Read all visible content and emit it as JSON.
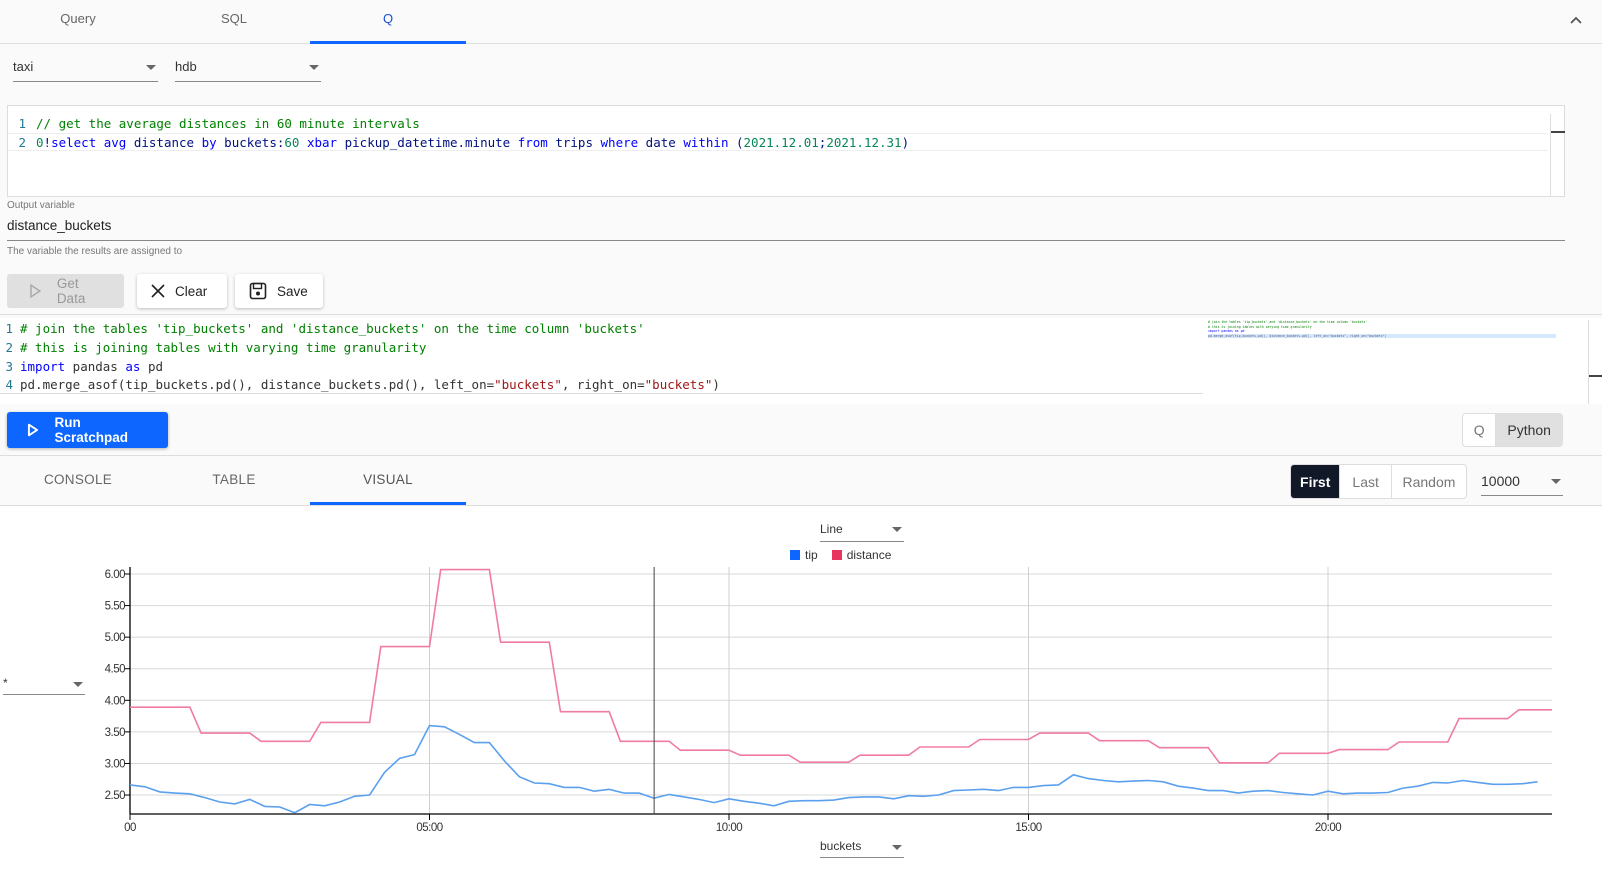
{
  "top_tabs": [
    {
      "label": "Query",
      "active": false
    },
    {
      "label": "SQL",
      "active": false
    },
    {
      "label": "Q",
      "active": true
    }
  ],
  "collapse_icon": "chevron-up-icon",
  "database_select": {
    "value": "taxi"
  },
  "source_select": {
    "value": "hdb"
  },
  "query_editor": {
    "lines": [
      "// get the average distances in 60 minute intervals",
      "0!select avg distance by buckets:60 xbar pickup_datetime.minute from trips where date within (2021.12.01;2021.12.31)"
    ]
  },
  "output_variable": {
    "label": "Output variable",
    "value": "distance_buckets",
    "hint": "The variable the results are assigned to"
  },
  "actions": {
    "get_data": "Get Data",
    "clear": "Clear",
    "save": "Save"
  },
  "scratchpad_editor": {
    "lines": [
      "# join the tables 'tip_buckets' and 'distance_buckets' on the time column 'buckets'",
      "# this is joining tables with varying time granularity",
      "import pandas as pd",
      "pd.merge_asof(tip_buckets.pd(), distance_buckets.pd(), left_on=\"buckets\", right_on=\"buckets\")"
    ]
  },
  "run_scratchpad": "Run Scratchpad",
  "language_toggle": [
    {
      "label": "Q",
      "active": false
    },
    {
      "label": "Python",
      "active": true
    }
  ],
  "result_tabs": [
    {
      "label": "CONSOLE",
      "active": false
    },
    {
      "label": "TABLE",
      "active": false
    },
    {
      "label": "VISUAL",
      "active": true
    }
  ],
  "sample_mode": [
    {
      "label": "First",
      "active": true
    },
    {
      "label": "Last",
      "active": false
    },
    {
      "label": "Random",
      "active": false
    }
  ],
  "row_limit": {
    "value": "10000"
  },
  "chart_type_select": {
    "value": "Line"
  },
  "y_select": {
    "value": "*"
  },
  "x_select": {
    "value": "buckets"
  },
  "colors": {
    "tip": "#5aa0ee",
    "distance": "#f07ca0",
    "accent": "#0d66ff",
    "legend_tip": "#0d66ff",
    "legend_distance": "#e8345e"
  },
  "chart_data": {
    "type": "line",
    "title": "",
    "xlabel": "buckets",
    "ylabel": "",
    "x_unit": "hours",
    "xlim": [
      0,
      23.75
    ],
    "ylim": [
      2.2,
      6.07
    ],
    "grid": true,
    "legend": "top-center",
    "x_ticks": [
      {
        "value": 0,
        "label": "00"
      },
      {
        "value": 5,
        "label": "05:00"
      },
      {
        "value": 10,
        "label": "10:00"
      },
      {
        "value": 15,
        "label": "15:00"
      },
      {
        "value": 20,
        "label": "20:00"
      }
    ],
    "y_ticks": [
      {
        "value": 2.5,
        "label": "2.50"
      },
      {
        "value": 3.0,
        "label": "3.00"
      },
      {
        "value": 3.5,
        "label": "3.50"
      },
      {
        "value": 4.0,
        "label": "4.00"
      },
      {
        "value": 4.5,
        "label": "4.50"
      },
      {
        "value": 5.0,
        "label": "5.00"
      },
      {
        "value": 5.5,
        "label": "5.50"
      },
      {
        "value": 6.0,
        "label": "6.00"
      }
    ],
    "cursor_x": 8.75,
    "series": [
      {
        "name": "tip",
        "x_step": 0.25,
        "values": [
          2.66,
          2.63,
          2.55,
          2.53,
          2.52,
          2.46,
          2.39,
          2.36,
          2.43,
          2.32,
          2.31,
          2.22,
          2.35,
          2.33,
          2.39,
          2.48,
          2.5,
          2.86,
          3.08,
          3.14,
          3.6,
          3.58,
          3.46,
          3.33,
          3.33,
          3.04,
          2.79,
          2.69,
          2.68,
          2.62,
          2.62,
          2.56,
          2.59,
          2.53,
          2.53,
          2.45,
          2.51,
          2.47,
          2.43,
          2.38,
          2.44,
          2.4,
          2.37,
          2.33,
          2.4,
          2.41,
          2.41,
          2.42,
          2.46,
          2.47,
          2.47,
          2.44,
          2.49,
          2.48,
          2.5,
          2.57,
          2.58,
          2.59,
          2.57,
          2.62,
          2.62,
          2.65,
          2.66,
          2.82,
          2.76,
          2.73,
          2.71,
          2.72,
          2.73,
          2.71,
          2.64,
          2.61,
          2.57,
          2.57,
          2.53,
          2.56,
          2.57,
          2.54,
          2.52,
          2.5,
          2.56,
          2.52,
          2.53,
          2.53,
          2.54,
          2.61,
          2.64,
          2.7,
          2.69,
          2.73,
          2.7,
          2.67,
          2.67,
          2.68,
          2.71
        ]
      },
      {
        "name": "distance",
        "x_step": 1,
        "step": true,
        "values": [
          3.89,
          3.48,
          3.35,
          3.65,
          4.85,
          6.07,
          4.92,
          3.82,
          3.35,
          3.21,
          3.13,
          3.02,
          3.13,
          3.26,
          3.38,
          3.48,
          3.36,
          3.25,
          3.01,
          3.16,
          3.22,
          3.34,
          3.71,
          3.85
        ]
      }
    ]
  }
}
